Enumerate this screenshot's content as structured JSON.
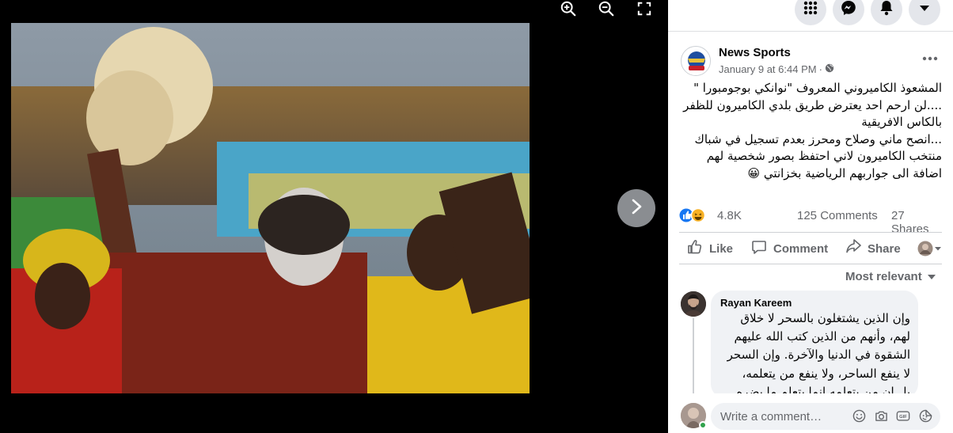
{
  "viewer": {
    "tools": [
      {
        "name": "zoom-in",
        "icon": "zoom-in-icon"
      },
      {
        "name": "zoom-out",
        "icon": "zoom-out-icon"
      },
      {
        "name": "fullscreen",
        "icon": "fullscreen-icon"
      }
    ],
    "next_icon": "chevron-right-icon"
  },
  "topbar": {
    "buttons": [
      {
        "icon": "menu-grid-icon"
      },
      {
        "icon": "messenger-icon"
      },
      {
        "icon": "bell-icon"
      },
      {
        "icon": "caret-down-icon"
      }
    ]
  },
  "post": {
    "page_name": "News Sports",
    "timestamp": "January 9 at 6:44 PM",
    "separator": "·",
    "audience_icon": "globe-icon",
    "text_lines": [
      "المشعوذ الكاميروني المعروف \"نوانكي بوجومبورا \"",
      "....لن ارحم احد يعترض طريق بلدي الكاميرون للظفر",
      "بالكاس الافريقية",
      "...انصح ماني وصلاح ومحرز بعدم تسجيل في شباك",
      "منتخب الكاميرون لاني احتفظ بصور شخصية لهم",
      "اضافة الى جواربهم الرياضية بخزانتي 😀"
    ],
    "reactions_count": "4.8K",
    "comments_count": "125 Comments",
    "shares_count": "27 Shares"
  },
  "actions": {
    "like": "Like",
    "comment": "Comment",
    "share": "Share"
  },
  "comments": {
    "sort_label": "Most relevant",
    "items": [
      {
        "author": "Rayan Kareem",
        "lines": [
          "وإن الذين يشتغلون بالسحر لا خلاق",
          "لهم، وأنهم من الذين كتب الله عليهم",
          "الشقوة في الدنيا والآخرة. وإن السحر",
          "لا ينفع الساحر، ولا ينفع من يتعلمه،",
          "بل إن من يتعلمه إنما يتعلم ما يضره"
        ]
      }
    ]
  },
  "composer": {
    "placeholder": "Write a comment…",
    "icons": [
      "emoji-icon",
      "camera-icon",
      "gif-icon",
      "sticker-icon"
    ]
  },
  "colors": {
    "accent": "#1877f2",
    "secondary_text": "#65676b",
    "bubble": "#f0f2f5"
  }
}
